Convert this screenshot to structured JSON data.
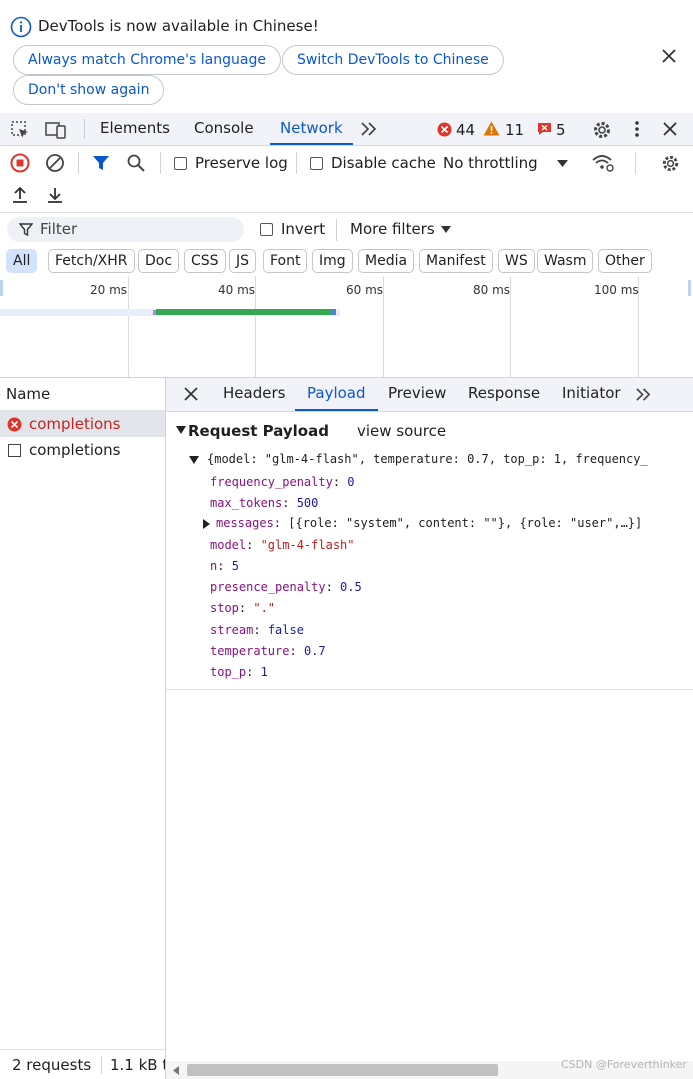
{
  "banner": {
    "message": "DevTools is now available in Chinese!",
    "btn_match": "Always match Chrome's language",
    "btn_switch": "Switch DevTools to Chinese",
    "btn_dont_show": "Don't show again"
  },
  "tabs": {
    "elements": "Elements",
    "console": "Console",
    "network": "Network",
    "errors": "44",
    "warnings": "11",
    "issues": "5"
  },
  "toolbar": {
    "preserve_log": "Preserve log",
    "disable_cache": "Disable cache",
    "throttling": "No throttling"
  },
  "filter": {
    "placeholder": "Filter",
    "invert": "Invert",
    "more_filters": "More filters",
    "chips": [
      "All",
      "Fetch/XHR",
      "Doc",
      "CSS",
      "JS",
      "Font",
      "Img",
      "Media",
      "Manifest",
      "WS",
      "Wasm",
      "Other"
    ]
  },
  "overview": {
    "ticks": [
      "20 ms",
      "40 ms",
      "60 ms",
      "80 ms",
      "100 ms"
    ]
  },
  "requests": {
    "header": "Name",
    "rows": [
      "completions",
      "completions"
    ],
    "status_count": "2 requests",
    "status_size": "1.1 kB t"
  },
  "detail_tabs": {
    "headers": "Headers",
    "payload": "Payload",
    "preview": "Preview",
    "response": "Response",
    "initiator": "Initiator"
  },
  "payload": {
    "section_title": "Request Payload",
    "view_source": "view source",
    "summary": "{model: \"glm-4-flash\", temperature: 0.7, top_p: 1, frequency_",
    "fields": {
      "frequency_penalty_key": "frequency_penalty",
      "frequency_penalty_val": "0",
      "max_tokens_key": "max_tokens",
      "max_tokens_val": "500",
      "messages_key": "messages",
      "messages_val": "[{role: \"system\", content: \"\"}, {role: \"user\",…}]",
      "model_key": "model",
      "model_val": "\"glm-4-flash\"",
      "n_key": "n",
      "n_val": "5",
      "presence_penalty_key": "presence_penalty",
      "presence_penalty_val": "0.5",
      "stop_key": "stop",
      "stop_val": "\".\"",
      "stream_key": "stream",
      "stream_val": "false",
      "temperature_key": "temperature",
      "temperature_val": "0.7",
      "top_p_key": "top_p",
      "top_p_val": "1"
    }
  },
  "watermark": "CSDN @Foreverthinker",
  "colors": {
    "accent": "#0b57d0",
    "error": "#dc362e",
    "warning": "#e37400",
    "waterfall_green": "#34a853"
  }
}
